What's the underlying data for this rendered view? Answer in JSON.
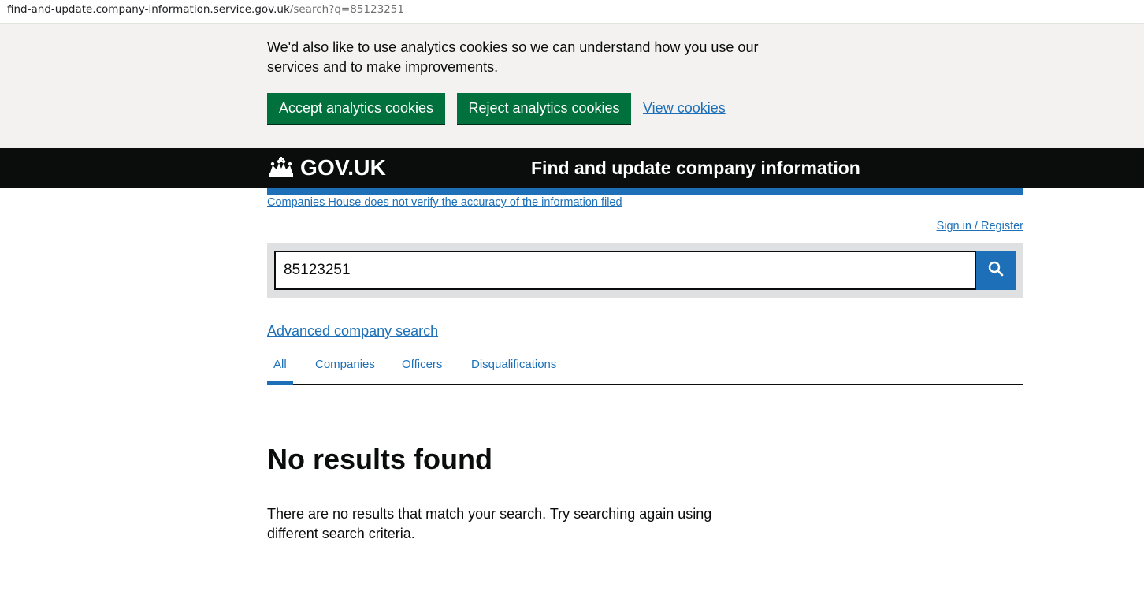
{
  "browser": {
    "url_host": "find-and-update.company-information.service.gov.uk",
    "url_path": "/search?q=85123251"
  },
  "cookie_banner": {
    "text": "We'd also like to use analytics cookies so we can understand how you use our services and to make improvements.",
    "accept_label": "Accept analytics cookies",
    "reject_label": "Reject analytics cookies",
    "view_label": "View cookies"
  },
  "header": {
    "logo_text": "GOV.UK",
    "service_name": "Find and update company information"
  },
  "notice": {
    "verify_link": "Companies House does not verify the accuracy of the information filed",
    "signin_link": "Sign in / Register"
  },
  "search": {
    "value": "85123251",
    "button_icon": "search-icon"
  },
  "advanced_search_label": "Advanced company search",
  "tabs": [
    {
      "label": "All",
      "active": true
    },
    {
      "label": "Companies",
      "active": false
    },
    {
      "label": "Officers",
      "active": false
    },
    {
      "label": "Disqualifications",
      "active": false
    }
  ],
  "results": {
    "heading": "No results found",
    "message": "There are no results that match your search. Try searching again using different search criteria."
  },
  "colors": {
    "brand_green": "#00703c",
    "link_blue": "#1d70b8",
    "header_black": "#0b0c0c",
    "banner_grey": "#f3f2f1"
  }
}
